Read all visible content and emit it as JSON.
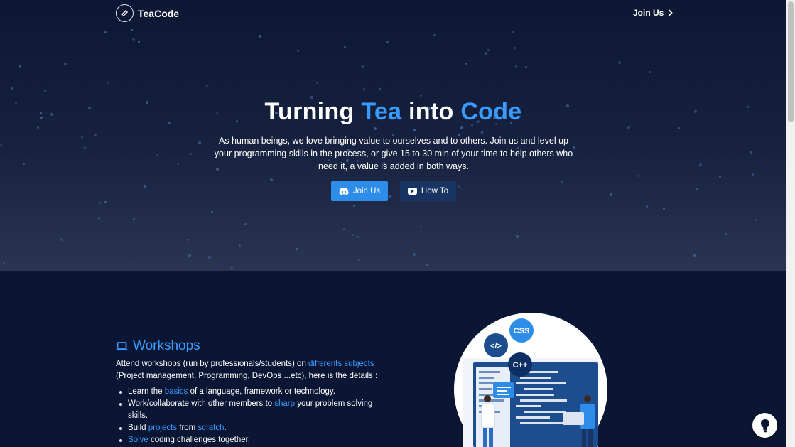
{
  "navbar": {
    "brand": "TeaCode",
    "join_label": "Join Us"
  },
  "hero": {
    "title_part1": "Turning",
    "title_accent1": "Tea",
    "title_part2": "into",
    "title_accent2": "Code",
    "description": "As human beings, we love bringing value to ourselves and to others. Join us and level up your programming skills in the process, or give 15 to 30 min of your time to help others who need it, a value is added in both ways.",
    "buttons": {
      "join_label": "Join Us",
      "howto_label": "How To"
    }
  },
  "workshops": {
    "title": "Workshops",
    "intro_pre": "Attend workshops (run by professionals/students) on ",
    "intro_hl": "differents subjects",
    "intro_post": " (Project management, Programming, DevOps ...etc), here is the details :",
    "items": [
      {
        "pre": "Learn the ",
        "hl": "basics",
        "post": " of a language, framework or technology."
      },
      {
        "pre": "Work/collaborate with other members to ",
        "hl": "sharp",
        "post": " your problem solving skills."
      },
      {
        "pre": "Build ",
        "hl": "projects",
        "mid": " from ",
        "hl2": "scratch",
        "post": "."
      },
      {
        "pre": "",
        "hl": "Solve",
        "post": " coding challenges together."
      }
    ],
    "illustration": {
      "badge_css": "CSS",
      "badge_html": "</>",
      "badge_cpp": "C++"
    }
  },
  "colors": {
    "accent": "#3a9bff",
    "join_button": "#2d8de8",
    "howto_button": "#173463",
    "page_bg": "#0a1633"
  },
  "icons": [
    "logo-icon",
    "chevron-right-icon",
    "moon-icon",
    "discord-icon",
    "youtube-icon",
    "laptop-icon",
    "lightbulb-icon"
  ]
}
